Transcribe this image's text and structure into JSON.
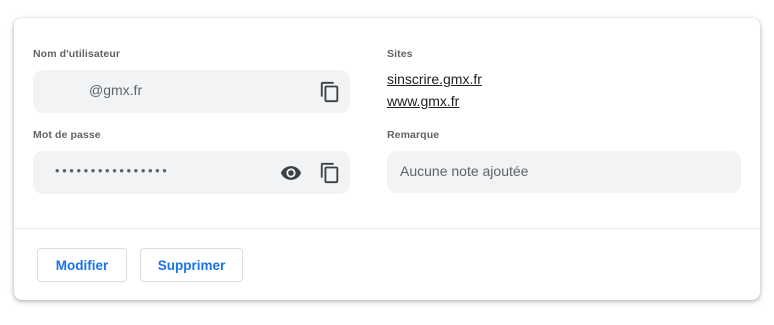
{
  "username": {
    "label": "Nom d'utilisateur",
    "value": "@gmx.fr"
  },
  "password": {
    "label": "Mot de passe",
    "value": "••••••••••••••••"
  },
  "sites": {
    "label": "Sites",
    "items": [
      "sinscrire.gmx.fr",
      "www.gmx.fr"
    ]
  },
  "note": {
    "label": "Remarque",
    "value": "Aucune note ajoutée"
  },
  "actions": {
    "edit_label": "Modifier",
    "delete_label": "Supprimer"
  },
  "icons": {
    "copy": "copy-icon",
    "show_password": "eye-icon"
  },
  "colors": {
    "accent": "#1a73e8",
    "field_bg": "#f1f3f4",
    "label": "#5f6368"
  }
}
